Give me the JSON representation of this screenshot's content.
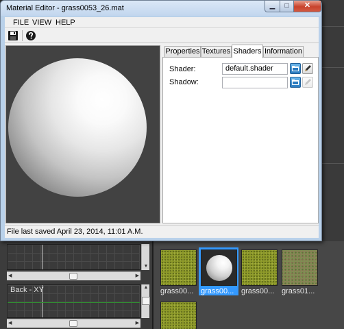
{
  "window": {
    "title": "Material Editor - grass0053_26.mat",
    "minimize_glyph": "▁",
    "maximize_glyph": "□",
    "close_glyph": "✕"
  },
  "menu": {
    "file": "FILE",
    "view": "VIEW",
    "help": "HELP"
  },
  "toolbar": {
    "save_icon": "floppy-disk-icon",
    "help_icon": "help-icon"
  },
  "tabs": [
    {
      "label": "Properties",
      "active": false
    },
    {
      "label": "Textures",
      "active": false
    },
    {
      "label": "Shaders",
      "active": true
    },
    {
      "label": "Information",
      "active": false
    }
  ],
  "shaders_panel": {
    "shader_label": "Shader:",
    "shader_value": "default.shader",
    "shadow_label": "Shadow:",
    "shadow_value": ""
  },
  "status": {
    "text": "File last saved April 23, 2014, 11:01 A.M."
  },
  "viewports": [
    {
      "label": ""
    },
    {
      "label": "Back - XY"
    }
  ],
  "browser": {
    "items": [
      {
        "caption": "grass00...",
        "selected": false
      },
      {
        "caption": "grass00...",
        "selected": true
      },
      {
        "caption": "grass00...",
        "selected": false
      },
      {
        "caption": "grass01...",
        "selected": false
      },
      {
        "caption": "",
        "selected": false
      }
    ]
  },
  "colors": {
    "selection": "#3399ff",
    "title_bar": "#c2d6ee",
    "close_button": "#c8432d"
  }
}
